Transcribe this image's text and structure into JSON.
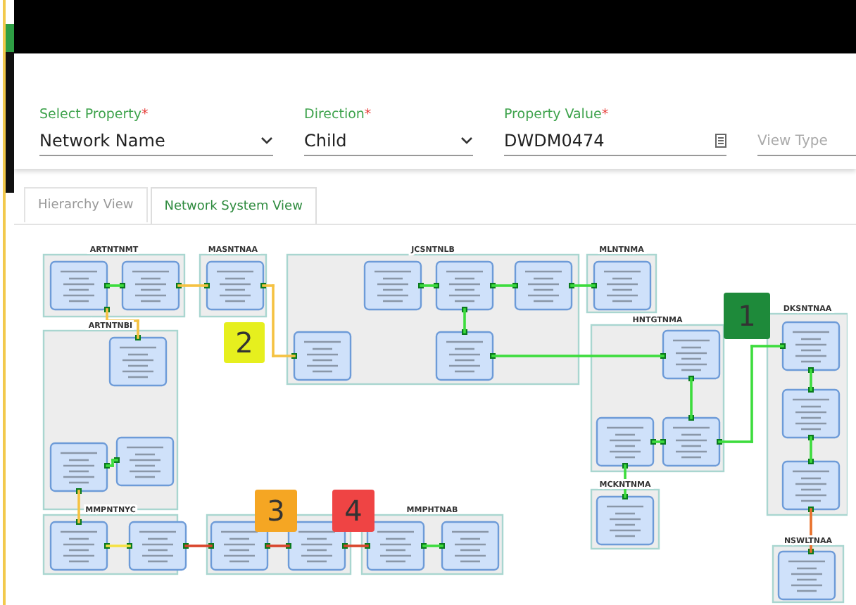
{
  "filters": [
    {
      "label": "Select Property",
      "required_mark": "*",
      "value": "Network Name",
      "kind": "select"
    },
    {
      "label": "Direction",
      "required_mark": "*",
      "value": "Child",
      "kind": "select"
    },
    {
      "label": "Property Value",
      "required_mark": "*",
      "value": "DWDM0474",
      "kind": "text"
    },
    {
      "placeholder": "View Type",
      "kind": "select"
    }
  ],
  "tabs": [
    {
      "label": "Hierarchy View",
      "selected": false
    },
    {
      "label": "Network System View",
      "selected": true
    }
  ],
  "diagram": {
    "clusters": [
      {
        "label": "ARTNTNMT"
      },
      {
        "label": "MASNTNAA"
      },
      {
        "label": "JCSNTNLB"
      },
      {
        "label": "MLNTNMA"
      },
      {
        "label": "ARTNTNBI"
      },
      {
        "label": "HNTGTNMA"
      },
      {
        "label": "DKSNTNAA"
      },
      {
        "label": "MCKNTNMA"
      },
      {
        "label": "NSWLTNAA"
      },
      {
        "label": "MMPNTNYC"
      },
      {
        "label": "MMPHTNAB"
      }
    ],
    "links": [
      {
        "color": "#f5c242"
      },
      {
        "color": "#f5c242"
      },
      {
        "color": "#f5c242"
      },
      {
        "color": "#3ddc3d"
      },
      {
        "color": "#3ddc3d"
      },
      {
        "color": "#3ddc3d"
      },
      {
        "color": "#3ddc3d"
      },
      {
        "color": "#3ddc3d"
      },
      {
        "color": "#3ddc3d"
      },
      {
        "color": "#3ddc3d"
      },
      {
        "color": "#3ddc3d"
      },
      {
        "color": "#3ddc3d"
      },
      {
        "color": "#3ddc3d"
      },
      {
        "color": "#3ddc3d"
      },
      {
        "color": "#3ddc3d"
      },
      {
        "color": "#e8702a"
      },
      {
        "color": "#3ddc3d"
      },
      {
        "color": "#f5c242"
      },
      {
        "color": "#f5e142"
      },
      {
        "color": "#d9452b"
      },
      {
        "color": "#d9452b"
      },
      {
        "color": "#d9452b"
      },
      {
        "color": "#3ddc3d"
      }
    ],
    "markers": [
      {
        "label": "1",
        "color": "#1e8a3a"
      },
      {
        "label": "2",
        "color": "#e6ef1e"
      },
      {
        "label": "3",
        "color": "#f5a623"
      },
      {
        "label": "4",
        "color": "#ef4444"
      }
    ]
  }
}
